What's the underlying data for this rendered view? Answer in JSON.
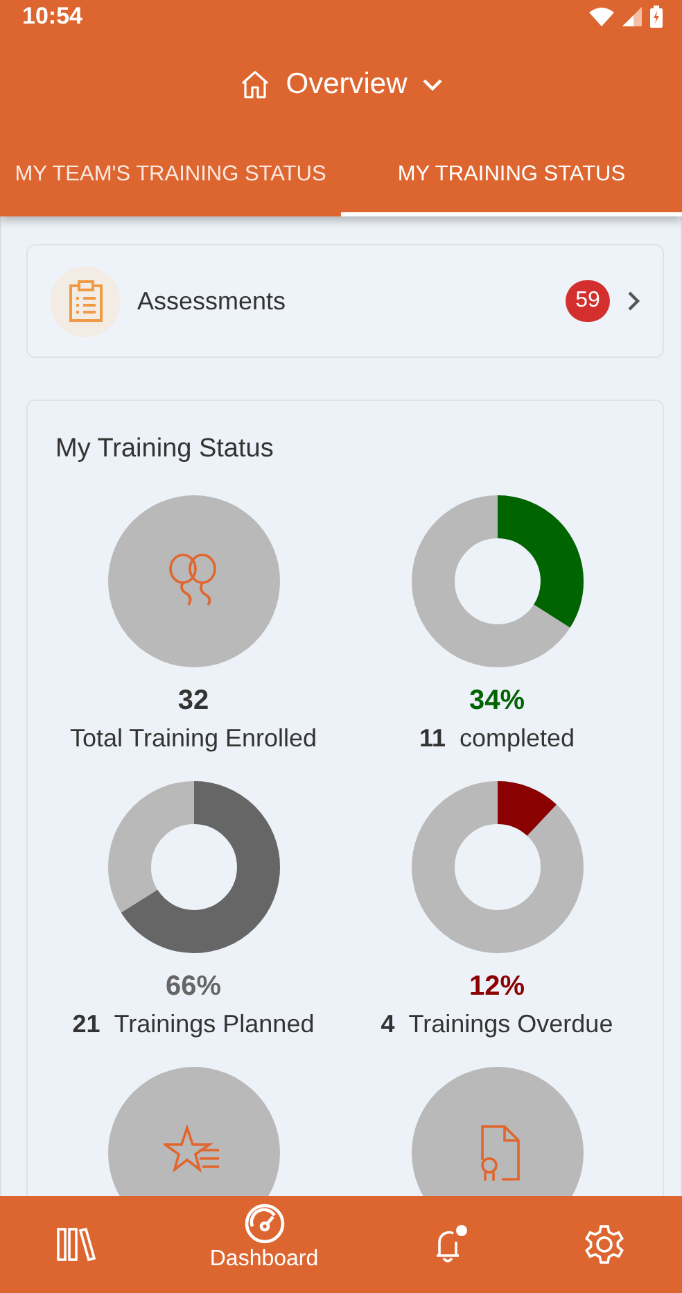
{
  "status_bar": {
    "time": "10:54"
  },
  "header": {
    "title": "Overview"
  },
  "tabs": [
    {
      "label": "MY TEAM'S TRAINING STATUS",
      "selected": false
    },
    {
      "label": "MY TRAINING STATUS",
      "selected": true
    }
  ],
  "assessments": {
    "label": "Assessments",
    "count": "59"
  },
  "training_status": {
    "title": "My Training Status",
    "tiles": [
      {
        "kind": "icon",
        "value": "32",
        "label": "Total Training Enrolled"
      },
      {
        "kind": "donut",
        "level": 0.34,
        "color": "#006400",
        "percent": "34%",
        "count": "11",
        "label": "completed"
      },
      {
        "kind": "donut",
        "level": 0.66,
        "color": "#666666",
        "percent": "66%",
        "count": "21",
        "label": "Trainings Planned"
      },
      {
        "kind": "donut",
        "level": 0.12,
        "color": "#8b0000",
        "percent": "12%",
        "count": "4",
        "label": "Trainings Overdue"
      },
      {
        "kind": "icon"
      },
      {
        "kind": "icon"
      }
    ]
  },
  "bottom_nav": [
    {
      "selected": false
    },
    {
      "label": "Dashboard",
      "selected": true
    },
    {
      "selected": false
    },
    {
      "selected": false
    }
  ]
}
